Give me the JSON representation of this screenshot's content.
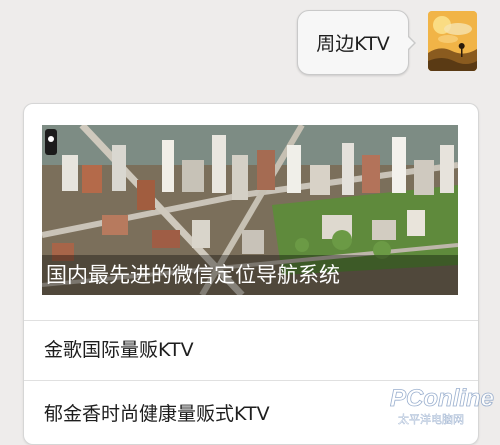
{
  "chat": {
    "sent_message": "周边KTV",
    "avatar_icon": "sunset-landscape-avatar"
  },
  "result_card": {
    "banner_caption": "国内最先进的微信定位导航系统",
    "items": [
      {
        "label": "金歌国际量贩KTV"
      },
      {
        "label": "郁金香时尚健康量贩式KTV"
      }
    ]
  },
  "watermark": {
    "logo_text": "PConline",
    "sub_text": "太平洋电脑网"
  }
}
